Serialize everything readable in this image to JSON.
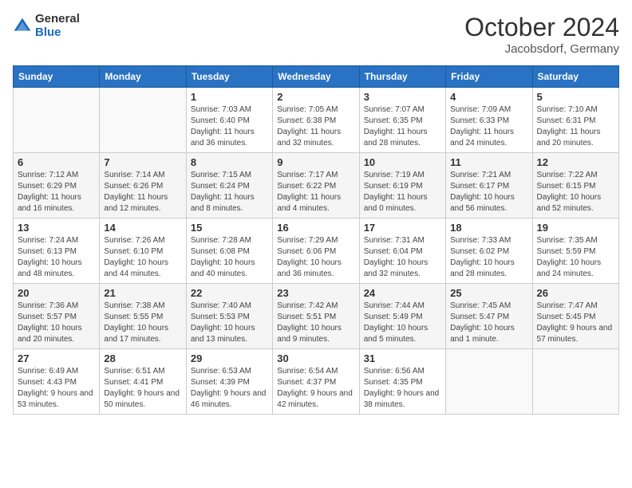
{
  "header": {
    "logo_general": "General",
    "logo_blue": "Blue",
    "title": "October 2024",
    "subtitle": "Jacobsdorf, Germany"
  },
  "days_of_week": [
    "Sunday",
    "Monday",
    "Tuesday",
    "Wednesday",
    "Thursday",
    "Friday",
    "Saturday"
  ],
  "weeks": [
    [
      {
        "day": "",
        "info": ""
      },
      {
        "day": "",
        "info": ""
      },
      {
        "day": "1",
        "info": "Sunrise: 7:03 AM\nSunset: 6:40 PM\nDaylight: 11 hours and 36 minutes."
      },
      {
        "day": "2",
        "info": "Sunrise: 7:05 AM\nSunset: 6:38 PM\nDaylight: 11 hours and 32 minutes."
      },
      {
        "day": "3",
        "info": "Sunrise: 7:07 AM\nSunset: 6:35 PM\nDaylight: 11 hours and 28 minutes."
      },
      {
        "day": "4",
        "info": "Sunrise: 7:09 AM\nSunset: 6:33 PM\nDaylight: 11 hours and 24 minutes."
      },
      {
        "day": "5",
        "info": "Sunrise: 7:10 AM\nSunset: 6:31 PM\nDaylight: 11 hours and 20 minutes."
      }
    ],
    [
      {
        "day": "6",
        "info": "Sunrise: 7:12 AM\nSunset: 6:29 PM\nDaylight: 11 hours and 16 minutes."
      },
      {
        "day": "7",
        "info": "Sunrise: 7:14 AM\nSunset: 6:26 PM\nDaylight: 11 hours and 12 minutes."
      },
      {
        "day": "8",
        "info": "Sunrise: 7:15 AM\nSunset: 6:24 PM\nDaylight: 11 hours and 8 minutes."
      },
      {
        "day": "9",
        "info": "Sunrise: 7:17 AM\nSunset: 6:22 PM\nDaylight: 11 hours and 4 minutes."
      },
      {
        "day": "10",
        "info": "Sunrise: 7:19 AM\nSunset: 6:19 PM\nDaylight: 11 hours and 0 minutes."
      },
      {
        "day": "11",
        "info": "Sunrise: 7:21 AM\nSunset: 6:17 PM\nDaylight: 10 hours and 56 minutes."
      },
      {
        "day": "12",
        "info": "Sunrise: 7:22 AM\nSunset: 6:15 PM\nDaylight: 10 hours and 52 minutes."
      }
    ],
    [
      {
        "day": "13",
        "info": "Sunrise: 7:24 AM\nSunset: 6:13 PM\nDaylight: 10 hours and 48 minutes."
      },
      {
        "day": "14",
        "info": "Sunrise: 7:26 AM\nSunset: 6:10 PM\nDaylight: 10 hours and 44 minutes."
      },
      {
        "day": "15",
        "info": "Sunrise: 7:28 AM\nSunset: 6:08 PM\nDaylight: 10 hours and 40 minutes."
      },
      {
        "day": "16",
        "info": "Sunrise: 7:29 AM\nSunset: 6:06 PM\nDaylight: 10 hours and 36 minutes."
      },
      {
        "day": "17",
        "info": "Sunrise: 7:31 AM\nSunset: 6:04 PM\nDaylight: 10 hours and 32 minutes."
      },
      {
        "day": "18",
        "info": "Sunrise: 7:33 AM\nSunset: 6:02 PM\nDaylight: 10 hours and 28 minutes."
      },
      {
        "day": "19",
        "info": "Sunrise: 7:35 AM\nSunset: 5:59 PM\nDaylight: 10 hours and 24 minutes."
      }
    ],
    [
      {
        "day": "20",
        "info": "Sunrise: 7:36 AM\nSunset: 5:57 PM\nDaylight: 10 hours and 20 minutes."
      },
      {
        "day": "21",
        "info": "Sunrise: 7:38 AM\nSunset: 5:55 PM\nDaylight: 10 hours and 17 minutes."
      },
      {
        "day": "22",
        "info": "Sunrise: 7:40 AM\nSunset: 5:53 PM\nDaylight: 10 hours and 13 minutes."
      },
      {
        "day": "23",
        "info": "Sunrise: 7:42 AM\nSunset: 5:51 PM\nDaylight: 10 hours and 9 minutes."
      },
      {
        "day": "24",
        "info": "Sunrise: 7:44 AM\nSunset: 5:49 PM\nDaylight: 10 hours and 5 minutes."
      },
      {
        "day": "25",
        "info": "Sunrise: 7:45 AM\nSunset: 5:47 PM\nDaylight: 10 hours and 1 minute."
      },
      {
        "day": "26",
        "info": "Sunrise: 7:47 AM\nSunset: 5:45 PM\nDaylight: 9 hours and 57 minutes."
      }
    ],
    [
      {
        "day": "27",
        "info": "Sunrise: 6:49 AM\nSunset: 4:43 PM\nDaylight: 9 hours and 53 minutes."
      },
      {
        "day": "28",
        "info": "Sunrise: 6:51 AM\nSunset: 4:41 PM\nDaylight: 9 hours and 50 minutes."
      },
      {
        "day": "29",
        "info": "Sunrise: 6:53 AM\nSunset: 4:39 PM\nDaylight: 9 hours and 46 minutes."
      },
      {
        "day": "30",
        "info": "Sunrise: 6:54 AM\nSunset: 4:37 PM\nDaylight: 9 hours and 42 minutes."
      },
      {
        "day": "31",
        "info": "Sunrise: 6:56 AM\nSunset: 4:35 PM\nDaylight: 9 hours and 38 minutes."
      },
      {
        "day": "",
        "info": ""
      },
      {
        "day": "",
        "info": ""
      }
    ]
  ]
}
